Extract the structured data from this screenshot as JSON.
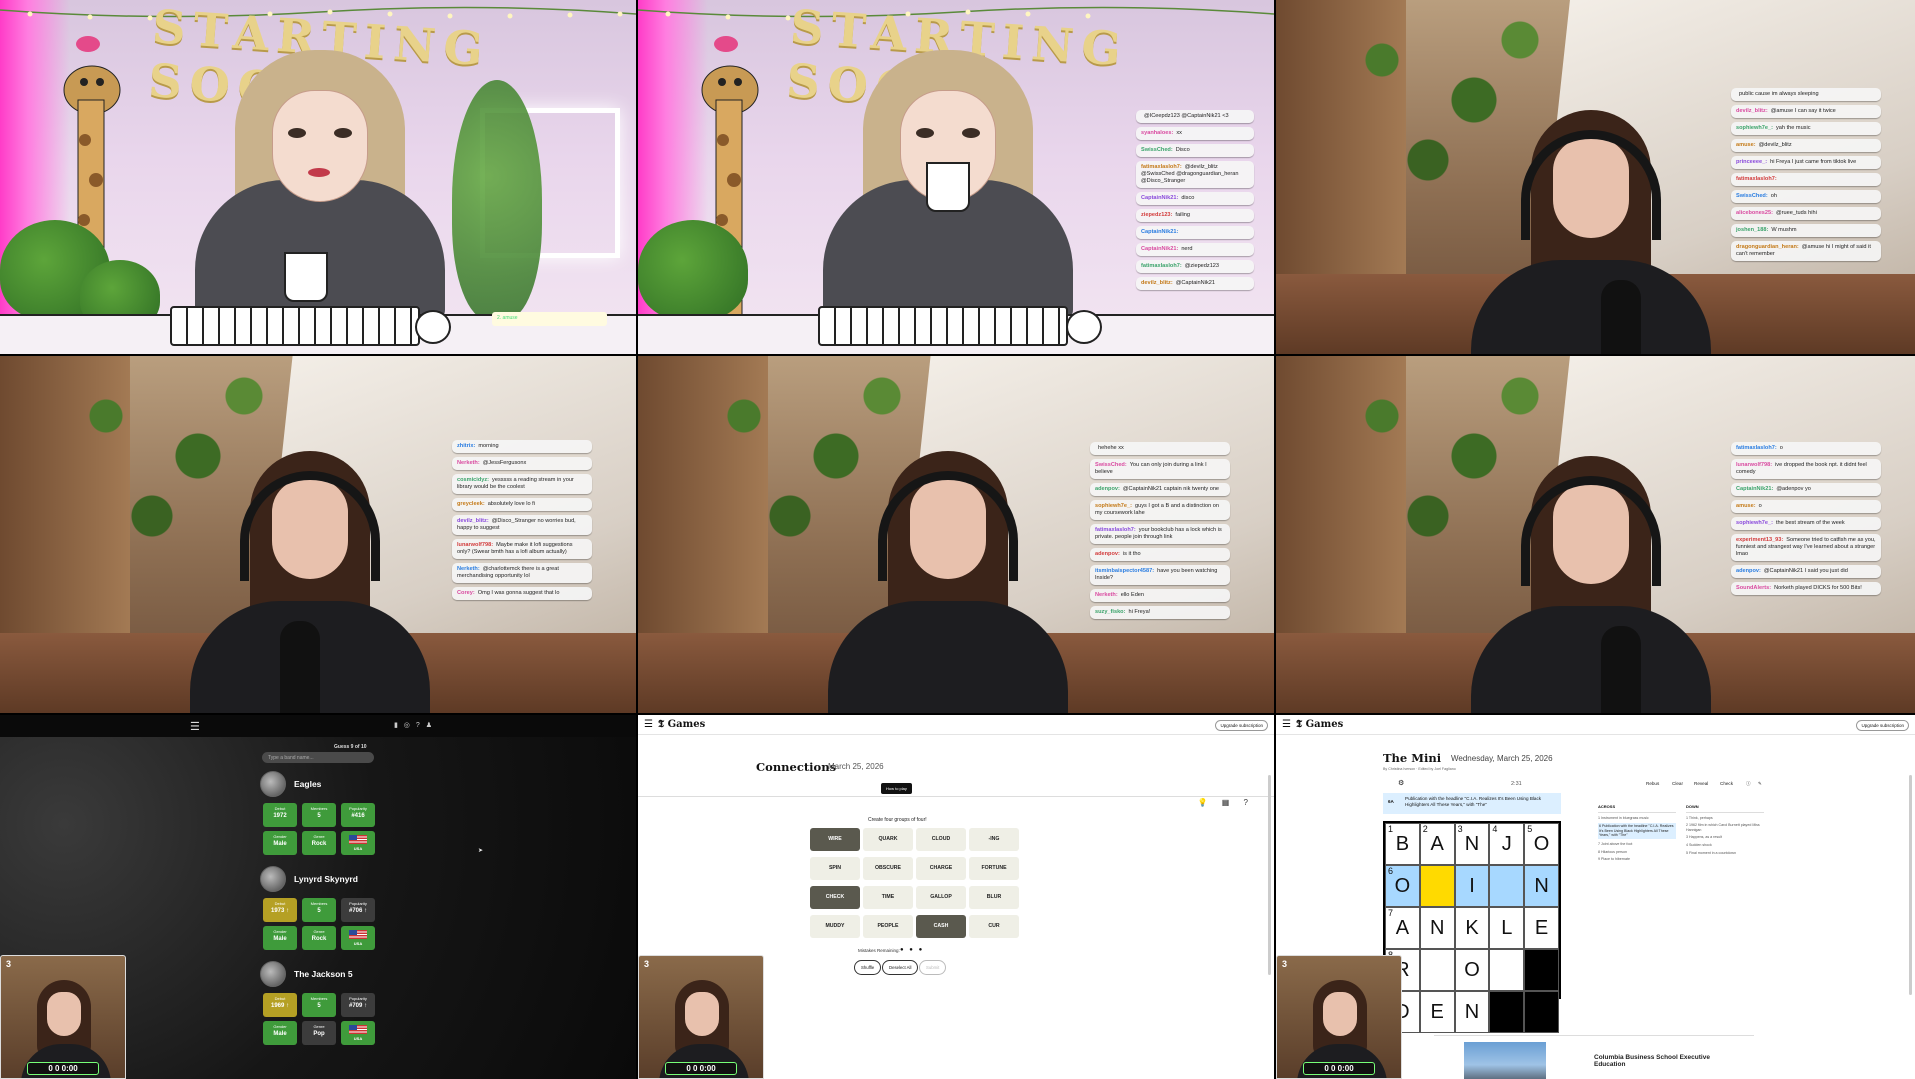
{
  "overlays": {
    "starting_soon": "STARTING SOON",
    "alert_text": "2. amuse",
    "timer": "0 0 0:00"
  },
  "chat_panel_1b": [
    {
      "user": "",
      "text": "@ICeepdz123 @CaptainNik21 <3"
    },
    {
      "user": "syanhaloes:",
      "text": "xx"
    },
    {
      "user": "SwissChed:",
      "text": "Disco"
    },
    {
      "user": "fatimaxlasloh7:",
      "text": "@devilz_blitz @SwissChed @dragonguardian_heran @Disco_Stranger"
    },
    {
      "user": "CaptainNik21:",
      "text": "disco"
    },
    {
      "user": "ziepedz123:",
      "text": "failing"
    },
    {
      "user": "CaptainNik21:",
      "text": ""
    },
    {
      "user": "CaptainNik21:",
      "text": "nerd"
    },
    {
      "user": "fatimaxlasloh7:",
      "text": "@ziepedz123"
    },
    {
      "user": "devilz_blitz:",
      "text": "@CaptainNik21"
    }
  ],
  "chat_panel_1c": [
    {
      "user": "",
      "text": "public cause im always sleeping"
    },
    {
      "user": "devilz_blitz:",
      "text": "@amuse I can say it twice"
    },
    {
      "user": "sophiewh7e_:",
      "text": "yah the music"
    },
    {
      "user": "amuse:",
      "text": "@devilz_blitz"
    },
    {
      "user": "princeeee_:",
      "text": "hi Freya I just came from tiktok live"
    },
    {
      "user": "fatimaxlasloh7:",
      "text": ""
    },
    {
      "user": "SwissChed:",
      "text": "oh"
    },
    {
      "user": "alicebones25:",
      "text": "@ruee_tuds hihi"
    },
    {
      "user": "joshen_188:",
      "text": "W mushm"
    },
    {
      "user": "dragonguardian_heran:",
      "text": "@amuse hi I might of said it can't remember"
    }
  ],
  "chat_panel_2a": [
    {
      "user": "zhitrix:",
      "text": "morning"
    },
    {
      "user": "Nerketh:",
      "text": "@JessFergusonx"
    },
    {
      "user": "cosmicidyz:",
      "text": "yesssss a reading stream in your library would be the coolest"
    },
    {
      "user": "greycleek:",
      "text": "absolutely love lo fi"
    },
    {
      "user": "devilz_blitz:",
      "text": "@Disco_Stranger no worries bud, happy to suggest"
    },
    {
      "user": "lunarwolf798:",
      "text": "Maybe make it lofi suggestions only? (Swear bmth has a lofi album actually)"
    },
    {
      "user": "Nerketh:",
      "text": "@charlottemck there is a great merchandising opportunity lol"
    },
    {
      "user": "Corey:",
      "text": "Omg I was gonna suggest that lo"
    }
  ],
  "chat_panel_2b": [
    {
      "user": "",
      "text": "hehehe xx"
    },
    {
      "user": "SwissChed:",
      "text": "You can only join during a link I believe"
    },
    {
      "user": "adenpov:",
      "text": "@CaptainNik21 captain nik twenty one"
    },
    {
      "user": "sophiewh7e_:",
      "text": "guys I got a B and a distinction on my coursework lahe"
    },
    {
      "user": "fatimaxlasloh7:",
      "text": "your bookclub has a lock which is private. people join through link"
    },
    {
      "user": "adenpov:",
      "text": "is it tho"
    },
    {
      "user": "itsminbaispector4587:",
      "text": "have you been watching Inside?"
    },
    {
      "user": "Nerketh:",
      "text": "ello Eden"
    },
    {
      "user": "suzy_fisko:",
      "text": "hi Freya!"
    }
  ],
  "chat_panel_2c": [
    {
      "user": "fatimaxlasloh7:",
      "text": "o"
    },
    {
      "user": "lunarwolf798:",
      "text": "ive dropped the book npt. it didnt feel comedy"
    },
    {
      "user": "CaptainNik21:",
      "text": "@adenpov yo"
    },
    {
      "user": "amuse:",
      "text": "o"
    },
    {
      "user": "sophiewh7e_:",
      "text": "the best stream of the week"
    },
    {
      "user": "experiment13_93:",
      "text": "Someone tried to catfish me as you, funniest and strangest way I've learned about a stranger lmao"
    },
    {
      "user": "adenpov:",
      "text": "@CaptainNik21 I said you just did"
    },
    {
      "user": "SoundAlerts:",
      "text": "Norketh played DICKS for 500 Bits!"
    }
  ],
  "band_game": {
    "guesses": "Guess 9 of 10",
    "search_placeholder": "Type a band name...",
    "bands": [
      {
        "name": "Eagles",
        "debut": "1972",
        "members": "5",
        "popularity": "#416",
        "gender": "Male",
        "genre": "Rock",
        "country": "USA",
        "colors": [
          "g",
          "g",
          "g",
          "g",
          "g",
          "g"
        ]
      },
      {
        "name": "Lynyrd Skynyrd",
        "debut": "1973 ↑",
        "members": "5",
        "popularity": "#706 ↑",
        "gender": "Male",
        "genre": "Rock",
        "country": "USA",
        "colors": [
          "y",
          "g",
          "k",
          "g",
          "g",
          "g"
        ]
      },
      {
        "name": "The Jackson 5",
        "debut": "1969 ↑",
        "members": "5",
        "popularity": "#709 ↑",
        "gender": "Male",
        "genre": "Pop",
        "country": "USA",
        "colors": [
          "y",
          "g",
          "k",
          "g",
          "k",
          "g"
        ]
      }
    ],
    "labels": {
      "debut": "Debut",
      "members": "Members",
      "popularity": "Popularity",
      "gender": "Gender",
      "genre": "Genre"
    }
  },
  "connections": {
    "logo": "Games",
    "upgrade": "Upgrade subscription",
    "title": "Connections",
    "date": "March 25, 2026",
    "how_to": "How to play",
    "subtitle": "Create four groups of four!",
    "words": [
      {
        "w": "WIRE",
        "sel": true
      },
      {
        "w": "QUARK",
        "sel": false
      },
      {
        "w": "CLOUD",
        "sel": false
      },
      {
        "w": "-ING",
        "sel": false
      },
      {
        "w": "SPIN",
        "sel": false
      },
      {
        "w": "OBSCURE",
        "sel": false
      },
      {
        "w": "CHARGE",
        "sel": false
      },
      {
        "w": "FORTUNE",
        "sel": false
      },
      {
        "w": "CHECK",
        "sel": true
      },
      {
        "w": "TIME",
        "sel": false
      },
      {
        "w": "GALLOP",
        "sel": false
      },
      {
        "w": "BLUR",
        "sel": false
      },
      {
        "w": "MUDDY",
        "sel": false
      },
      {
        "w": "PEOPLE",
        "sel": false
      },
      {
        "w": "CASH",
        "sel": true
      },
      {
        "w": "CUR",
        "sel": false
      }
    ],
    "mistakes_label": "Mistakes Remaining:",
    "mistakes_dots": "● ● ●",
    "buttons": {
      "shuffle": "Shuffle",
      "deselect": "Deselect All",
      "submit": "Submit"
    }
  },
  "mini": {
    "logo": "Games",
    "upgrade": "Upgrade subscription",
    "title": "The Mini",
    "date": "Wednesday, March 25, 2026",
    "byline": "By Christina Iverson · Edited by Joel Fagliano",
    "timer": "2:31",
    "tools": {
      "rebus": "Rebus",
      "clear": "Clear",
      "reveal": "Reveal",
      "check": "Check"
    },
    "clue_num": "6A",
    "clue_text": "Publication with the headline \"C.I.A. Realizes It's Been Using Black Highlighters All These Years,\" with \"The\"",
    "grid": [
      [
        {
          "n": "1",
          "l": "B",
          "s": ""
        },
        {
          "n": "2",
          "l": "A",
          "s": ""
        },
        {
          "n": "3",
          "l": "N",
          "s": ""
        },
        {
          "n": "4",
          "l": "J",
          "s": ""
        },
        {
          "n": "5",
          "l": "O",
          "s": ""
        }
      ],
      [
        {
          "n": "6",
          "l": "O",
          "s": "hl"
        },
        {
          "n": "",
          "l": "",
          "s": "cur"
        },
        {
          "n": "",
          "l": "I",
          "s": "hl"
        },
        {
          "n": "",
          "l": "",
          "s": "hl"
        },
        {
          "n": "",
          "l": "N",
          "s": "hl"
        }
      ],
      [
        {
          "n": "7",
          "l": "A",
          "s": ""
        },
        {
          "n": "",
          "l": "N",
          "s": ""
        },
        {
          "n": "",
          "l": "K",
          "s": ""
        },
        {
          "n": "",
          "l": "L",
          "s": ""
        },
        {
          "n": "",
          "l": "E",
          "s": ""
        }
      ],
      [
        {
          "n": "8",
          "l": "R",
          "s": ""
        },
        {
          "n": "",
          "l": "",
          "s": ""
        },
        {
          "n": "",
          "l": "O",
          "s": ""
        },
        {
          "n": "",
          "l": "",
          "s": ""
        },
        {
          "n": "",
          "l": "",
          "s": "blk"
        }
      ],
      [
        {
          "n": "9",
          "l": "D",
          "s": ""
        },
        {
          "n": "",
          "l": "E",
          "s": ""
        },
        {
          "n": "",
          "l": "N",
          "s": ""
        },
        {
          "n": "",
          "l": "",
          "s": "blk"
        },
        {
          "n": "",
          "l": "",
          "s": "blk"
        }
      ]
    ],
    "across_title": "ACROSS",
    "down_title": "DOWN",
    "across": [
      {
        "t": "1 Instrument in bluegrass music",
        "on": false
      },
      {
        "t": "6 Publication with the headline \"C.I.A. Realizes It's Been Using Black Highlighters All These Years,\" with \"The\"",
        "on": true
      },
      {
        "t": "7 Joint above the foot",
        "on": false
      },
      {
        "t": "8 Hilarious person",
        "on": false
      },
      {
        "t": "9 Place to hibernate",
        "on": false
      }
    ],
    "down": [
      {
        "t": "1 Think, perhaps",
        "on": false
      },
      {
        "t": "2 1962 film in which Carol Burnett played Miss Hannigan",
        "on": false
      },
      {
        "t": "3 Happens, as a result",
        "on": false
      },
      {
        "t": "4 Sudden shock",
        "on": false
      },
      {
        "t": "5 Final moment in a countdown",
        "on": false
      }
    ],
    "ad_title": "Columbia Business School Executive Education"
  }
}
